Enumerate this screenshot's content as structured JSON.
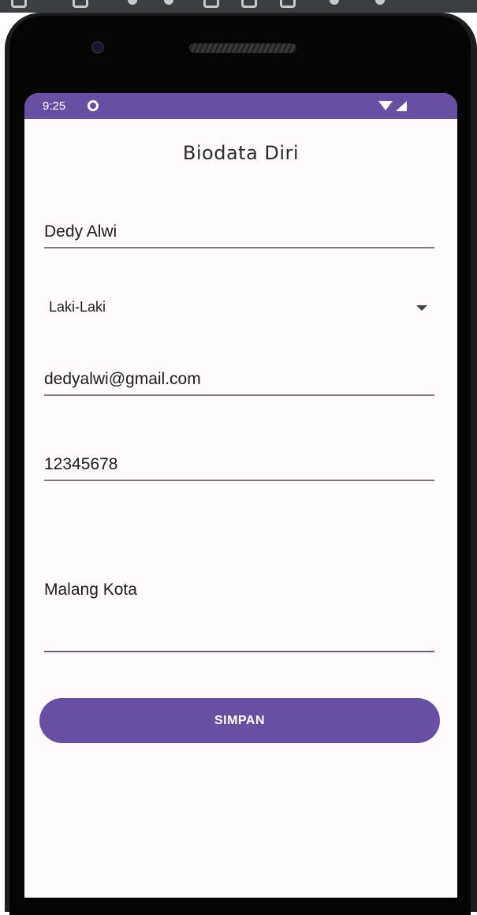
{
  "status_bar": {
    "time": "9:25",
    "notification_icon": "circle-icon",
    "wifi_icon": "wifi-icon",
    "signal_icon": "signal-icon",
    "background_color": "#6750a4"
  },
  "form": {
    "title": "Biodata Diri",
    "name_value": "Dedy Alwi",
    "gender_selected": "Laki-Laki",
    "email_value": "dedyalwi@gmail.com",
    "phone_value": "12345678",
    "address_value": "Malang Kota",
    "submit_label": "SIMPAN"
  },
  "colors": {
    "accent": "#6750a4",
    "background": "#fffbfe"
  }
}
